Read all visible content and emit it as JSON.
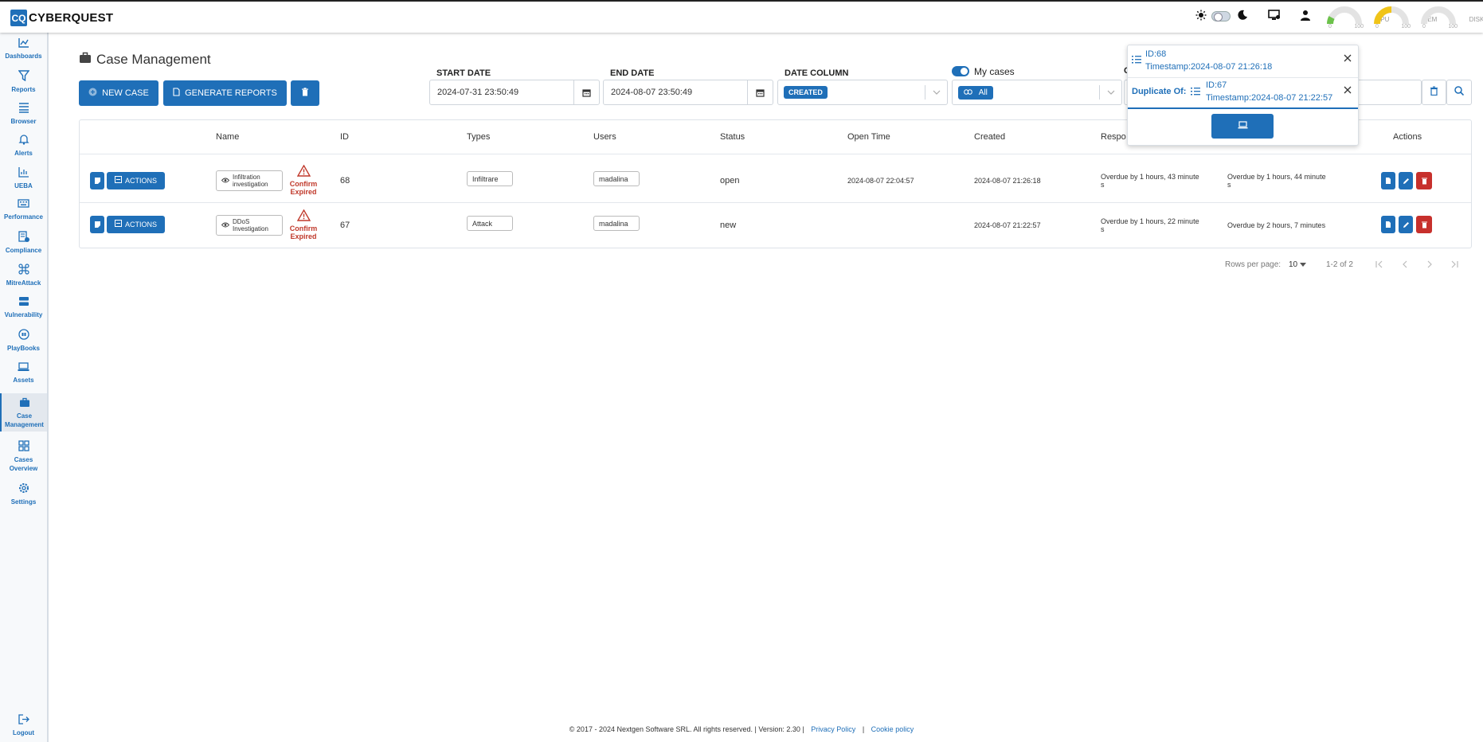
{
  "app": {
    "logo_mark": "CQ",
    "logo_text": "CYBERQUEST"
  },
  "topbar": {
    "gauges": [
      {
        "label": "CPU",
        "min": "0",
        "max": "100",
        "color": "#6cc24a",
        "level": 0.1
      },
      {
        "label": "MEM",
        "min": "0",
        "max": "100",
        "color": "#f0c419",
        "level": 0.5
      },
      {
        "label": "DISK",
        "min": "0",
        "max": "100",
        "color": "#cccccc",
        "level": 0.0
      }
    ]
  },
  "sidebar": {
    "items": [
      {
        "label": "Dashboards",
        "icon": "dashboard-icon"
      },
      {
        "label": "Reports",
        "icon": "filter-icon"
      },
      {
        "label": "Browser",
        "icon": "list-icon"
      },
      {
        "label": "Alerts",
        "icon": "bell-icon"
      },
      {
        "label": "UEBA",
        "icon": "chart-icon"
      },
      {
        "label": "Performance",
        "icon": "keyboard-icon"
      },
      {
        "label": "Compliance",
        "icon": "compliance-icon"
      },
      {
        "label": "MitreAttack",
        "icon": "command-icon"
      },
      {
        "label": "Vulnerability",
        "icon": "server-icon"
      },
      {
        "label": "PlayBooks",
        "icon": "playbook-icon"
      },
      {
        "label": "Assets",
        "icon": "laptop-icon"
      },
      {
        "label": "Case Management",
        "icon": "briefcase-icon"
      },
      {
        "label": "Cases Overview",
        "icon": "grid-icon"
      },
      {
        "label": "Settings",
        "icon": "gear-icon"
      }
    ],
    "logout": "Logout"
  },
  "page": {
    "title": "Case Management",
    "new_case": "NEW CASE",
    "generate_reports": "GENERATE REPORTS"
  },
  "filters": {
    "start_date_label": "START DATE",
    "start_date_value": "2024-07-31 23:50:49",
    "end_date_label": "END DATE",
    "end_date_value": "2024-08-07 23:50:49",
    "date_column_label": "DATE COLUMN",
    "date_column_value": "CREATED",
    "my_cases_label": "My cases",
    "my_cases_value": "All",
    "hidden_label_initial": "C"
  },
  "table": {
    "headers": [
      "Name",
      "ID",
      "Types",
      "Users",
      "Status",
      "Open Time",
      "Created",
      "Respo",
      "Actions"
    ],
    "actions_label": "ACTIONS",
    "rows": [
      {
        "name_line1": "Infiltration",
        "name_line2": "investigation",
        "warning_line1": "Confirm",
        "warning_line2": "Expired",
        "id": "68",
        "type": "Infiltrare",
        "user": "madalina",
        "status": "open",
        "open_time": "2024-08-07 22:04:57",
        "created": "2024-08-07 21:26:18",
        "response_line1": "Overdue by 1 hours, 43 minute",
        "response_line2": "s",
        "resolution_line1": "Overdue by 1 hours, 44 minute",
        "resolution_line2": "s"
      },
      {
        "name_line1": "DDoS",
        "name_line2": "Investigation",
        "warning_line1": "Confirm",
        "warning_line2": "Expired",
        "id": "67",
        "type": "Attack",
        "user": "madalina",
        "status": "new",
        "open_time": "",
        "created": "2024-08-07 21:22:57",
        "response_line1": "Overdue by 1 hours, 22 minute",
        "response_line2": "s",
        "resolution_line1": "Overdue by 2 hours, 7 minutes",
        "resolution_line2": ""
      }
    ]
  },
  "pagination": {
    "rows_per_page_label": "Rows per page:",
    "rows_per_page_value": "10",
    "range": "1-2 of 2"
  },
  "popup": {
    "item1_id": "ID:68",
    "item1_timestamp": "Timestamp:2024-08-07 21:26:18",
    "duplicate_label": "Duplicate Of:",
    "item2_id": "ID:67",
    "item2_timestamp": "Timestamp:2024-08-07 21:22:57"
  },
  "footer": {
    "text": "© 2017 - 2024 Nextgen Software SRL. All rights reserved. | Version: 2.30 |",
    "privacy": "Privacy Policy",
    "separator": "|",
    "cookie": "Cookie policy"
  }
}
